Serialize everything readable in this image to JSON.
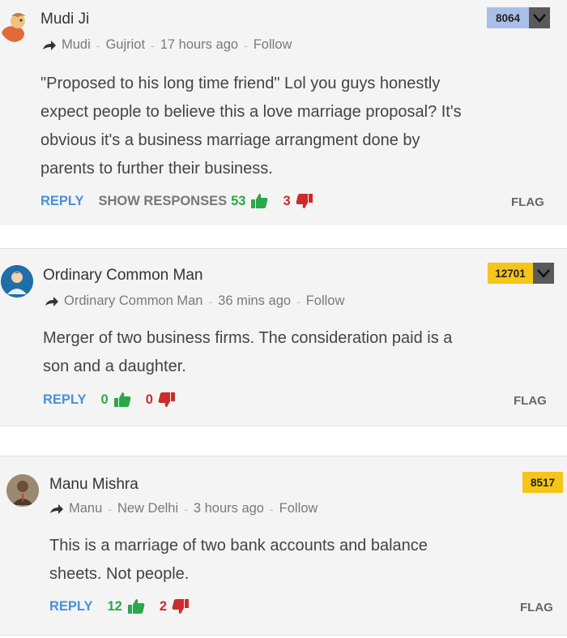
{
  "comments": [
    {
      "name": "Mudi Ji",
      "meta": {
        "short_name": "Mudi",
        "location": "Gujriot",
        "time": "17 hours ago",
        "follow": "Follow"
      },
      "body_lines": [
        "\"Proposed to his long time friend\" Lol you guys honestly",
        "expect people to believe this a love marriage proposal? It's",
        "obvious it's a business marriage arrangment done by",
        "parents to further their business."
      ],
      "reply": "REPLY",
      "show_responses": "SHOW RESPONSES",
      "upvotes": "53",
      "downvotes": "3",
      "flag": "FLAG",
      "badge": "8064",
      "badge_color": "#a9bfe8"
    },
    {
      "name": "Ordinary Common Man",
      "meta": {
        "short_name": "Ordinary Common Man",
        "time": "36 mins ago",
        "follow": "Follow"
      },
      "body_lines": [
        "Merger of two business firms. The consideration paid is a",
        "son and a daughter."
      ],
      "reply": "REPLY",
      "upvotes": "0",
      "downvotes": "0",
      "flag": "FLAG",
      "badge": "12701",
      "badge_color": "#f5c518"
    },
    {
      "name": "Manu Mishra",
      "meta": {
        "short_name": "Manu",
        "location": "New Delhi",
        "time": "3 hours ago",
        "follow": "Follow"
      },
      "body_lines": [
        "This is a marriage of two bank accounts and balance",
        "sheets. Not people."
      ],
      "reply": "REPLY",
      "upvotes": "12",
      "downvotes": "2",
      "flag": "FLAG",
      "badge": "8517",
      "badge_color": "#f5c518"
    }
  ],
  "colors": {
    "reply": "#4a90d9",
    "upvote": "#2aa84a",
    "downvote": "#cc2b2b"
  },
  "icons": {
    "share": "share-arrow-icon",
    "up": "thumbs-up-icon",
    "down": "thumbs-down-icon",
    "menu": "chevron-down-icon"
  }
}
